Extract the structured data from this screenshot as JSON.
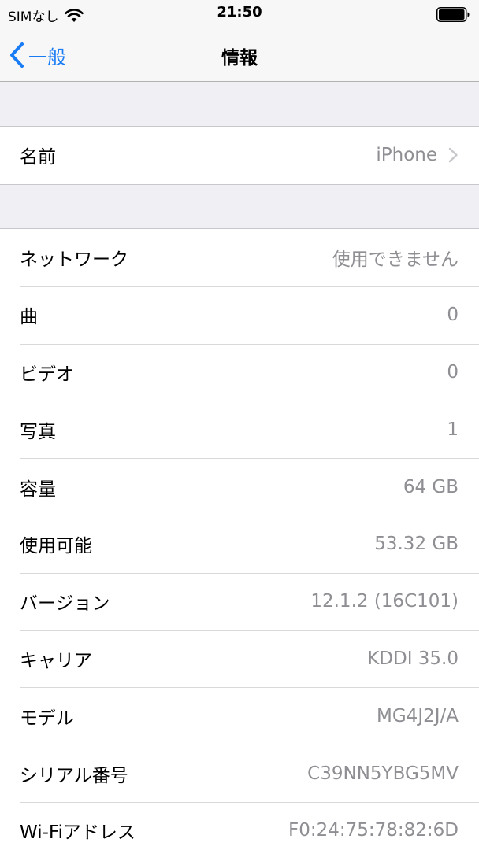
{
  "status_bar": {
    "carrier": "SIMなし",
    "time": "21:50"
  },
  "nav": {
    "back_label": "一般",
    "title": "情報"
  },
  "name_row": {
    "label": "名前",
    "value": "iPhone"
  },
  "info_rows": [
    {
      "label": "ネットワーク",
      "value": "使用できません"
    },
    {
      "label": "曲",
      "value": "0"
    },
    {
      "label": "ビデオ",
      "value": "0"
    },
    {
      "label": "写真",
      "value": "1"
    },
    {
      "label": "容量",
      "value": "64 GB"
    },
    {
      "label": "使用可能",
      "value": "53.32 GB"
    },
    {
      "label": "バージョン",
      "value": "12.1.2 (16C101)"
    },
    {
      "label": "キャリア",
      "value": "KDDI 35.0"
    },
    {
      "label": "モデル",
      "value": "MG4J2J/A"
    },
    {
      "label": "シリアル番号",
      "value": "C39NN5YBG5MV"
    },
    {
      "label": "Wi-Fiアドレス",
      "value": "F0:24:75:78:82:6D"
    }
  ],
  "colors": {
    "accent": "#1a7cf5",
    "secondary_text": "#8e8e93",
    "background": "#efeff4"
  }
}
